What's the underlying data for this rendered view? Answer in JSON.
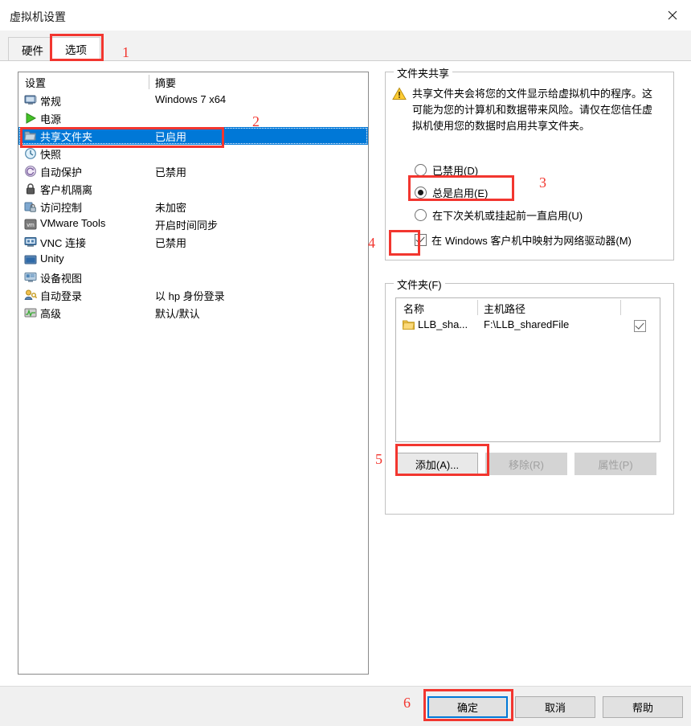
{
  "window": {
    "title": "虚拟机设置",
    "close_label": "关闭"
  },
  "tabs": [
    {
      "label": "硬件",
      "active": false
    },
    {
      "label": "选项",
      "active": true
    }
  ],
  "settings_list": {
    "col_name": "设置",
    "col_summary": "摘要",
    "rows": [
      {
        "icon": "monitor-icon",
        "label": "常规",
        "summary": "Windows 7 x64",
        "selected": false
      },
      {
        "icon": "play-icon",
        "label": "电源",
        "summary": "",
        "selected": false
      },
      {
        "icon": "folder-icon",
        "label": "共享文件夹",
        "summary": "已启用",
        "selected": true
      },
      {
        "icon": "snapshot-icon",
        "label": "快照",
        "summary": "",
        "selected": false
      },
      {
        "icon": "autoprotect-icon",
        "label": "自动保护",
        "summary": "已禁用",
        "selected": false
      },
      {
        "icon": "lock-icon",
        "label": "客户机隔离",
        "summary": "",
        "selected": false
      },
      {
        "icon": "access-control-icon",
        "label": "访问控制",
        "summary": "未加密",
        "selected": false
      },
      {
        "icon": "vmware-tools-icon",
        "label": "VMware Tools",
        "summary": "开启时间同步",
        "selected": false
      },
      {
        "icon": "vnc-icon",
        "label": "VNC 连接",
        "summary": "已禁用",
        "selected": false
      },
      {
        "icon": "unity-icon",
        "label": "Unity",
        "summary": "",
        "selected": false
      },
      {
        "icon": "device-view-icon",
        "label": "设备视图",
        "summary": "",
        "selected": false
      },
      {
        "icon": "autologin-icon",
        "label": "自动登录",
        "summary": "以 hp 身份登录",
        "selected": false
      },
      {
        "icon": "advanced-icon",
        "label": "高级",
        "summary": "默认/默认",
        "selected": false
      }
    ]
  },
  "folder_sharing": {
    "group_title": "文件夹共享",
    "warning_text": "共享文件夹会将您的文件显示给虚拟机中的程序。这可能为您的计算机和数据带来风险。请仅在您信任虚拟机使用您的数据时启用共享文件夹。",
    "radios": [
      {
        "label": "已禁用(D)",
        "selected": false
      },
      {
        "label": "总是启用(E)",
        "selected": true
      },
      {
        "label": "在下次关机或挂起前一直启用(U)",
        "selected": false
      }
    ],
    "map_drive": {
      "label_prefix": "在",
      "label_rest": "Windows 客户机中映射为网络驱动器(M)",
      "checked": true
    }
  },
  "folders": {
    "group_title": "文件夹(F)",
    "columns": [
      "名称",
      "主机路径",
      ""
    ],
    "rows": [
      {
        "icon": "folder-icon",
        "name": "LLB_sha...",
        "path": "F:\\LLB_sharedFile",
        "enabled": true
      }
    ],
    "buttons": [
      {
        "label": "添加(A)...",
        "enabled": true
      },
      {
        "label": "移除(R)",
        "enabled": false
      },
      {
        "label": "属性(P)",
        "enabled": false
      }
    ]
  },
  "footer": {
    "ok": "确定",
    "cancel": "取消",
    "help": "帮助"
  },
  "annotations": [
    {
      "number": "1"
    },
    {
      "number": "2"
    },
    {
      "number": "3"
    },
    {
      "number": "4"
    },
    {
      "number": "5"
    },
    {
      "number": "6"
    }
  ],
  "colors": {
    "selection_blue": "#0078d7",
    "annotation_red": "#f2362f",
    "warning_yellow": "#ffcc33"
  }
}
